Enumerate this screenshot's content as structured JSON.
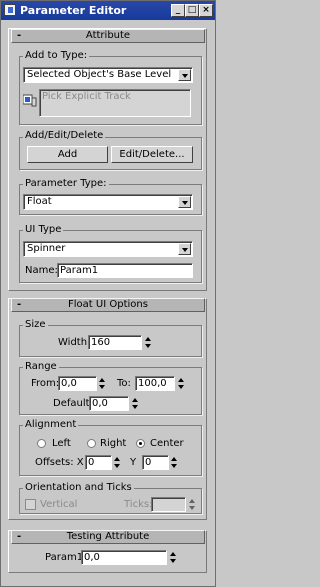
{
  "window": {
    "title": "Parameter Editor",
    "minimize": "_",
    "maximize": "□",
    "close": "×"
  },
  "attribute": {
    "header": "Attribute",
    "add_to_type": {
      "label": "Add to Type:",
      "value": "Selected Object's Base Level",
      "pick_placeholder": "Pick Explicit Track"
    },
    "add_edit_delete": {
      "label": "Add/Edit/Delete",
      "add": "Add",
      "edit_delete": "Edit/Delete..."
    },
    "parameter_type": {
      "label": "Parameter Type:",
      "value": "Float"
    },
    "ui_type": {
      "label": "UI Type",
      "value": "Spinner",
      "name_label": "Name:",
      "name_value": "Param1"
    }
  },
  "float_ui": {
    "header": "Float UI Options",
    "size": {
      "label": "Size",
      "width_label": "Width:",
      "width_value": "160"
    },
    "range": {
      "label": "Range",
      "from_label": "From:",
      "from_value": "0,0",
      "to_label": "To:",
      "to_value": "100,0",
      "default_label": "Default:",
      "default_value": "0,0"
    },
    "alignment": {
      "label": "Alignment",
      "left": "Left",
      "right": "Right",
      "center": "Center",
      "selected": "center",
      "offsets_label": "Offsets: X",
      "x_value": "0",
      "y_label": "Y",
      "y_value": "0"
    },
    "orientation": {
      "label": "Orientation and Ticks",
      "vertical": "Vertical",
      "ticks_label": "Ticks:",
      "ticks_value": ""
    }
  },
  "testing": {
    "header": "Testing Attribute",
    "param_label": "Param1:",
    "param_value": "0,0"
  },
  "icons": {
    "pick_track": "pick-track-icon"
  }
}
